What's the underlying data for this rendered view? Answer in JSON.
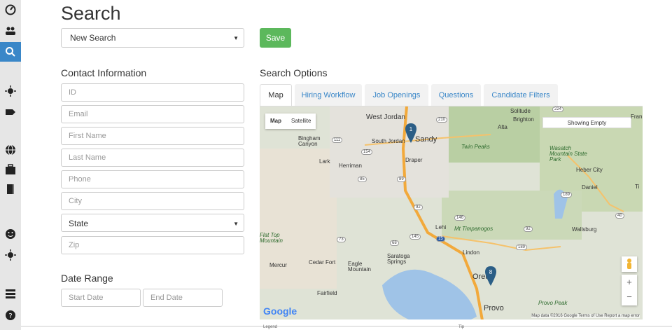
{
  "page": {
    "title": "Search"
  },
  "search": {
    "selected": "New Search",
    "save_label": "Save"
  },
  "contact": {
    "heading": "Contact Information",
    "id_ph": "ID",
    "email_ph": "Email",
    "first_ph": "First Name",
    "last_ph": "Last Name",
    "phone_ph": "Phone",
    "city_ph": "City",
    "state": "State",
    "zip_ph": "Zip"
  },
  "date_range": {
    "heading": "Date Range",
    "start_ph": "Start Date",
    "end_ph": "End Date"
  },
  "options": {
    "heading": "Search Options",
    "tabs": [
      "Map",
      "Hiring Workflow",
      "Job Openings",
      "Questions",
      "Candidate Filters"
    ]
  },
  "map": {
    "type_map": "Map",
    "type_sat": "Satellite",
    "showing": "Showing Empty",
    "brand": "Google",
    "footer": "Map data ©2016 Google   Terms of Use   Report a map error",
    "markers": [
      "1",
      "8"
    ],
    "cities": [
      "West Jordan",
      "Sandy",
      "South Jordan",
      "Draper",
      "Herriman",
      "Bingham Canyon",
      "Lark",
      "Alta",
      "Brighton",
      "Solitude",
      "Twin Peaks",
      "Wasatch Mountain State Park",
      "Heber City",
      "Daniel",
      "Lehi",
      "Mt Timpanogos",
      "Wallsburg",
      "Flat Top Mountain",
      "Cedar Fort",
      "Eagle Mountain",
      "Saratoga Springs",
      "Lindon",
      "Orem",
      "Mercur",
      "Fairfield",
      "Provo",
      "Provo Peak",
      "Fran",
      "Ti"
    ],
    "highways": [
      "210",
      "154",
      "89",
      "85",
      "92",
      "146",
      "145",
      "73",
      "68",
      "15",
      "189",
      "40",
      "92",
      "111",
      "224",
      "189"
    ]
  },
  "below": {
    "left": "Legend",
    "right": "Tip"
  },
  "sidebar": {
    "icons": [
      "dashboard-icon",
      "users-icon",
      "search-icon",
      "sun-icon",
      "tag-icon",
      "globe-icon",
      "briefcase-icon",
      "book-icon",
      "smiley-icon",
      "sun-icon",
      "list-icon",
      "help-icon"
    ]
  },
  "colors": {
    "accent": "#3a87c8",
    "save": "#5cb85c"
  }
}
